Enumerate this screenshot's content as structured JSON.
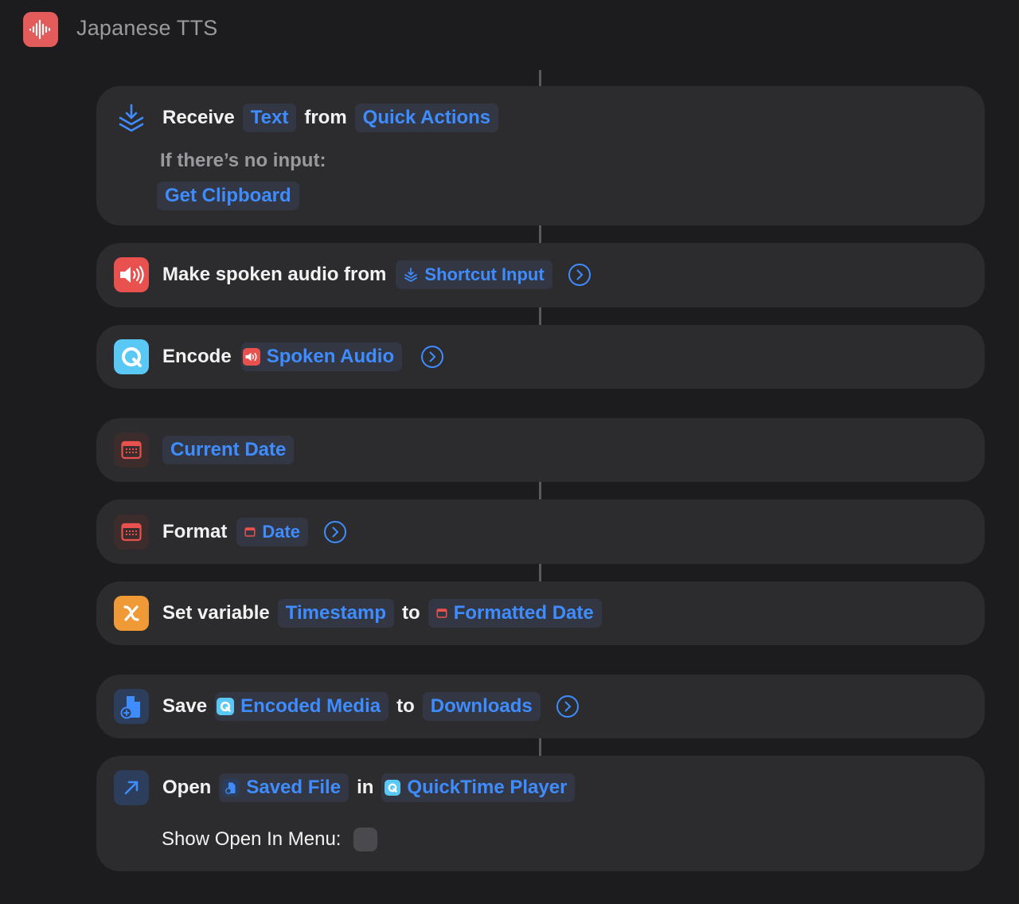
{
  "header": {
    "title": "Japanese TTS",
    "app_icon": "waveform-icon",
    "app_color": "#e45b5b"
  },
  "accent_color": "#3f8cff",
  "actions": {
    "receive": {
      "verb": "Receive",
      "input_type": "Text",
      "from_word": "from",
      "source": "Quick Actions",
      "no_input_label": "If there’s no input:",
      "fallback": "Get Clipboard"
    },
    "speak": {
      "verb": "Make spoken audio from",
      "input": "Shortcut Input"
    },
    "encode": {
      "verb": "Encode",
      "input": "Spoken Audio"
    },
    "current_date": {
      "value": "Current Date"
    },
    "format": {
      "verb": "Format",
      "input": "Date"
    },
    "set_variable": {
      "verb": "Set variable",
      "name": "Timestamp",
      "to_word": "to",
      "value": "Formatted Date"
    },
    "save": {
      "verb": "Save",
      "input": "Encoded Media",
      "to_word": "to",
      "destination": "Downloads"
    },
    "open": {
      "verb": "Open",
      "input": "Saved File",
      "in_word": "in",
      "app": "QuickTime Player",
      "option_label": "Show Open In Menu:",
      "option_enabled": false
    }
  }
}
